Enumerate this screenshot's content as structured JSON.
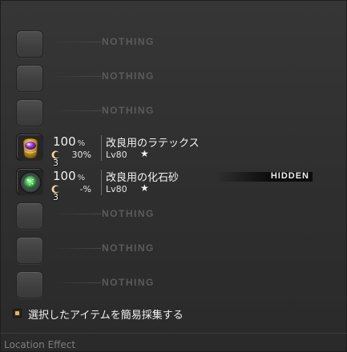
{
  "slots": [
    {
      "type": "empty",
      "label": "NOTHING"
    },
    {
      "type": "empty",
      "label": "NOTHING"
    },
    {
      "type": "empty",
      "label": "NOTHING"
    },
    {
      "type": "item",
      "icon": "latex-icon",
      "quantity": "3",
      "gather_rate": "100",
      "gather_rate_unit": "%",
      "hq_rate": "30%",
      "name": "改良用のラテックス",
      "level": "Lv80",
      "star": "★"
    },
    {
      "type": "item",
      "icon": "fossil-sand-icon",
      "quantity": "3",
      "gather_rate": "100",
      "gather_rate_unit": "%",
      "hq_rate": "-%",
      "name": "改良用の化石砂",
      "level": "Lv80",
      "star": "★",
      "badge": "HIDDEN"
    },
    {
      "type": "empty",
      "label": "NOTHING"
    },
    {
      "type": "empty",
      "label": "NOTHING"
    },
    {
      "type": "empty",
      "label": "NOTHING"
    }
  ],
  "quick_gather": {
    "label": "選択したアイテムを簡易採集する",
    "checked": true,
    "accent": "#e9b64a"
  },
  "footer": {
    "location_effect": "Location Effect"
  }
}
